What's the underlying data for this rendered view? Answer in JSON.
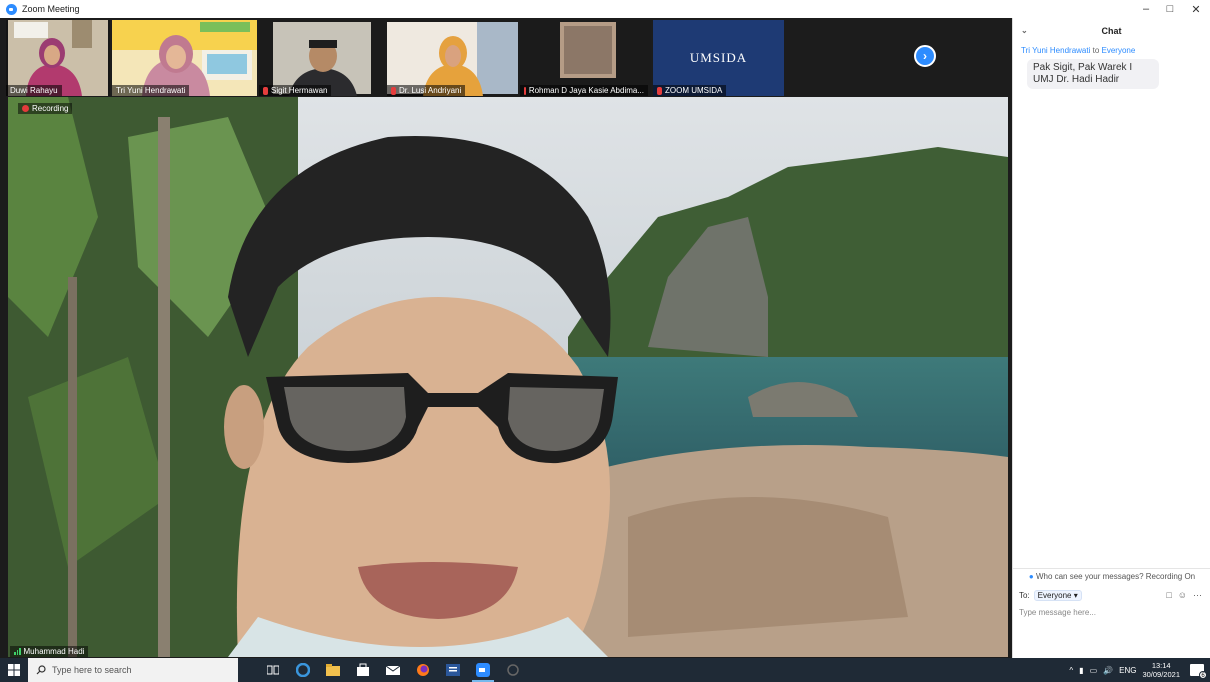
{
  "window": {
    "title": "Zoom Meeting",
    "minimize": "–",
    "restore": "□",
    "close": "✕"
  },
  "gallery": {
    "participants": [
      {
        "name": "Duwi Rahayu",
        "muted": false
      },
      {
        "name": "Tri Yuni Hendrawati",
        "muted": false
      },
      {
        "name": "Sigit Hermawan",
        "muted": true
      },
      {
        "name": "Dr. Lusi Andriyani",
        "muted": true
      },
      {
        "name": "Rohman D Jaya Kasie Abdima...",
        "muted": true
      },
      {
        "name": "ZOOM UMSIDA",
        "muted": true
      }
    ],
    "umsida_logo_text": "UMSIDA",
    "next_icon": "chevron-right-icon"
  },
  "main_video": {
    "recording_label": "Recording",
    "speaker_name": "Muhammad Hadi"
  },
  "chat": {
    "title": "Chat",
    "message": {
      "sender": "Tri Yuni Hendrawati",
      "to_word": "to",
      "recipient": "Everyone",
      "text": "Pak Sigit, Pak Warek I UMJ Dr. Hadi Hadir"
    },
    "visibility_notice": "Who can see your messages? Recording On",
    "to_label": "To:",
    "to_value": "Everyone",
    "input_placeholder": "Type message here..."
  },
  "taskbar": {
    "search_placeholder": "Type here to search",
    "language": "ENG",
    "time": "13:14",
    "date": "30/09/2021",
    "notification_count": "6"
  },
  "colors": {
    "accent": "#2d8cff",
    "recording": "#e23b3b",
    "taskbar": "#1f2a36"
  }
}
